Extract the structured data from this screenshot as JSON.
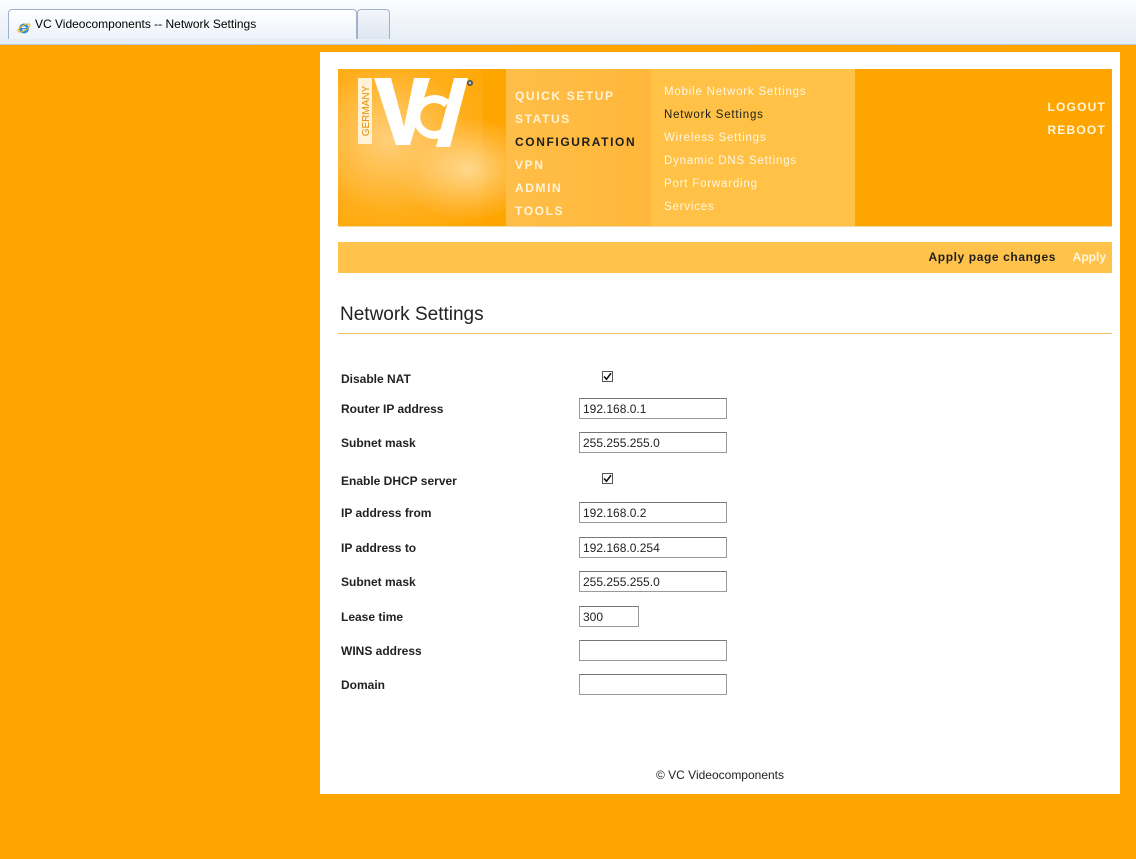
{
  "browser": {
    "tab_title": "VC Videocomponents -- Network Settings"
  },
  "logo": {
    "country_text": "GERMANY",
    "brand_text": "VC"
  },
  "main_menu": [
    {
      "label": "QUICK SETUP",
      "active": false
    },
    {
      "label": "STATUS",
      "active": false
    },
    {
      "label": "CONFIGURATION",
      "active": true
    },
    {
      "label": "VPN",
      "active": false
    },
    {
      "label": "ADMIN",
      "active": false
    },
    {
      "label": "TOOLS",
      "active": false
    }
  ],
  "sub_menu": [
    {
      "label": "Mobile Network Settings",
      "active": false
    },
    {
      "label": "Network Settings",
      "active": true
    },
    {
      "label": "Wireless Settings",
      "active": false
    },
    {
      "label": "Dynamic DNS Settings",
      "active": false
    },
    {
      "label": "Port Forwarding",
      "active": false
    },
    {
      "label": "Services",
      "active": false
    }
  ],
  "top_right": {
    "logout": "LOGOUT",
    "reboot": "REBOOT"
  },
  "apply_bar": {
    "label": "Apply page changes",
    "button": "Apply"
  },
  "page_title": "Network Settings",
  "form": {
    "disable_nat": {
      "label": "Disable NAT",
      "checked": true
    },
    "router_ip": {
      "label": "Router IP address",
      "value": "192.168.0.1"
    },
    "subnet_mask": {
      "label": "Subnet mask",
      "value": "255.255.255.0"
    },
    "enable_dhcp": {
      "label": "Enable DHCP server",
      "checked": true
    },
    "ip_from": {
      "label": "IP address from",
      "value": "192.168.0.2"
    },
    "ip_to": {
      "label": "IP address to",
      "value": "192.168.0.254"
    },
    "dhcp_subnet_mask": {
      "label": "Subnet mask",
      "value": "255.255.255.0"
    },
    "lease_time": {
      "label": "Lease time",
      "value": "300"
    },
    "wins_address": {
      "label": "WINS address",
      "value": ""
    },
    "domain": {
      "label": "Domain",
      "value": ""
    }
  },
  "footer": "© VC Videocomponents",
  "colors": {
    "background": "#FFA500",
    "menu_highlight": "#FFC247",
    "title_rule": "#F4BD55"
  }
}
